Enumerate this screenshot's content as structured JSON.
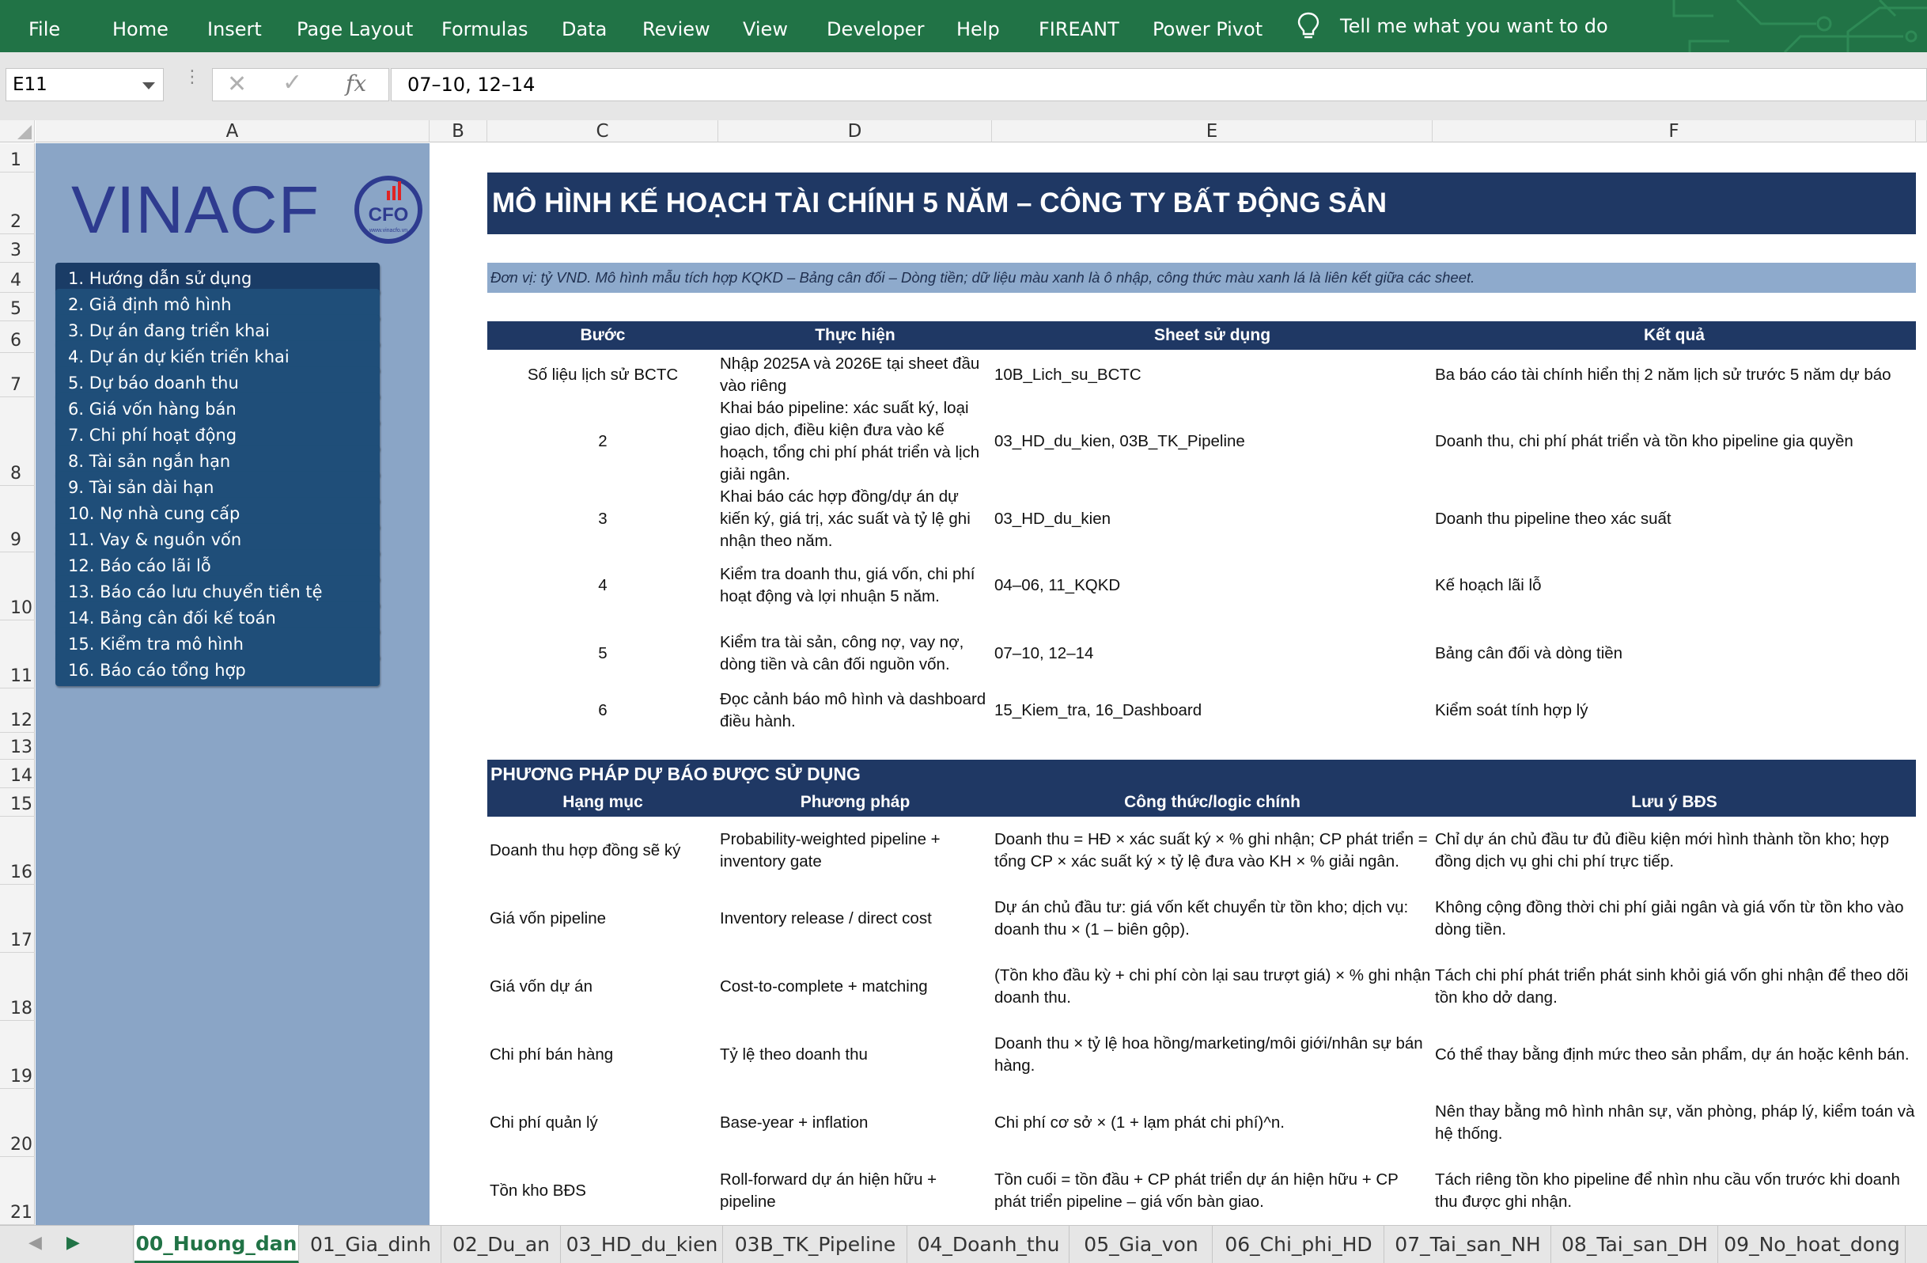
{
  "ribbon": {
    "tabs": [
      "File",
      "Home",
      "Insert",
      "Page Layout",
      "Formulas",
      "Data",
      "Review",
      "View",
      "Developer",
      "Help",
      "FIREANT",
      "Power Pivot"
    ],
    "tell_me": "Tell me what you want to do",
    "tell_icon": "lightbulb-icon",
    "color": "#217346"
  },
  "formula_bar": {
    "name_box": "E11",
    "cancel_glyph": "✕",
    "enter_glyph": "✓",
    "fx_label": "fx",
    "formula": "07–10, 12–14"
  },
  "columns": [
    "A",
    "B",
    "C",
    "D",
    "E",
    "F"
  ],
  "rows": [
    "1",
    "2",
    "3",
    "4",
    "5",
    "6",
    "7",
    "8",
    "9",
    "10",
    "11",
    "12",
    "13",
    "14",
    "15",
    "16",
    "17",
    "18",
    "19",
    "20",
    "21"
  ],
  "sidebar": {
    "logo_text": "VINACF",
    "logo_badge": "CFO",
    "logo_url": "www.vinacfo.vn",
    "nav": [
      "1. Hướng dẫn sử dụng",
      "2. Giả định mô hình",
      "3. Dự án đang triển khai",
      "4. Dự án dự kiến triển khai",
      "5. Dự báo doanh thu",
      "6. Giá vốn hàng bán",
      "7. Chi phí hoạt động",
      "8. Tài sản ngắn hạn",
      "9. Tài sản dài hạn",
      "10. Nợ nhà cung cấp",
      "11. Vay & nguồn vốn",
      "12. Báo cáo lãi lỗ",
      "13. Báo cáo lưu chuyển tiền tệ",
      "14. Bảng cân đối kế toán",
      "15. Kiểm tra mô hình",
      "16. Báo cáo tổng hợp"
    ]
  },
  "sheet": {
    "title": "MÔ HÌNH KẾ HOẠCH TÀI CHÍNH 5 NĂM – CÔNG TY BẤT ĐỘNG SẢN",
    "note": "Đơn vị: tỷ VND. Mô hình mẫu tích hợp KQKD – Bảng cân đối – Dòng tiền; dữ liệu màu xanh là ô nhập, công thức màu xanh lá là liên kết giữa các sheet.",
    "steps_header": [
      "Bước",
      "Thực hiện",
      "Sheet sử dụng",
      "Kết quả"
    ],
    "steps": [
      [
        "Số liệu lịch sử BCTC",
        "Nhập 2025A và 2026E tại sheet đầu vào riêng",
        "10B_Lich_su_BCTC",
        "Ba báo cáo tài chính hiển thị 2 năm lịch sử trước 5 năm dự báo"
      ],
      [
        "2",
        "Khai báo pipeline: xác suất ký, loại giao dịch, điều kiện đưa vào kế hoạch, tổng chi phí phát triển và lịch giải ngân.",
        "03_HD_du_kien, 03B_TK_Pipeline",
        "Doanh thu, chi phí phát triển và tồn kho pipeline gia quyền"
      ],
      [
        "3",
        "Khai báo các hợp đồng/dự án dự kiến ký, giá trị, xác suất và tỷ lệ ghi nhận theo năm.",
        "03_HD_du_kien",
        "Doanh thu pipeline theo xác suất"
      ],
      [
        "4",
        "Kiểm tra doanh thu, giá vốn, chi phí hoạt động và lợi nhuận 5 năm.",
        "04–06, 11_KQKD",
        "Kế hoạch lãi lỗ"
      ],
      [
        "5",
        "Kiểm tra tài sản, công nợ, vay nợ, dòng tiền và cân đối nguồn vốn.",
        "07–10, 12–14",
        "Bảng cân đối và dòng tiền"
      ],
      [
        "6",
        "Đọc cảnh báo mô hình và dashboard điều hành.",
        "15_Kiem_tra, 16_Dashboard",
        "Kiểm soát tính hợp lý"
      ]
    ],
    "methods_title": "PHƯƠNG PHÁP DỰ BÁO ĐƯỢC SỬ DỤNG",
    "methods_header": [
      "Hạng mục",
      "Phương pháp",
      "Công thức/logic chính",
      "Lưu ý BĐS"
    ],
    "methods": [
      [
        "Doanh thu hợp đồng sẽ ký",
        "Probability-weighted pipeline + inventory gate",
        "Doanh thu = HĐ × xác suất ký × % ghi nhận; CP phát triển = tổng CP × xác suất ký × tỷ lệ đưa vào KH × % giải ngân.",
        "Chỉ dự án chủ đầu tư đủ điều kiện mới hình thành tồn kho; hợp đồng dịch vụ ghi chi phí trực tiếp."
      ],
      [
        "Giá vốn pipeline",
        "Inventory release / direct cost",
        "Dự án chủ đầu tư: giá vốn kết chuyển từ tồn kho; dịch vụ: doanh thu × (1 – biên gộp).",
        "Không cộng đồng thời chi phí giải ngân và giá vốn từ tồn kho vào dòng tiền."
      ],
      [
        "Giá vốn dự án",
        "Cost-to-complete + matching",
        "(Tồn kho đầu kỳ + chi phí còn lại sau trượt giá) × % ghi nhận doanh thu.",
        "Tách chi phí phát triển phát sinh khỏi giá vốn ghi nhận để theo dõi tồn kho dở dang."
      ],
      [
        "Chi phí bán hàng",
        "Tỷ lệ theo doanh thu",
        "Doanh thu × tỷ lệ hoa hồng/marketing/môi giới/nhân sự bán hàng.",
        "Có thể thay bằng định mức theo sản phẩm, dự án hoặc kênh bán."
      ],
      [
        "Chi phí quản lý",
        "Base-year + inflation",
        "Chi phí cơ sở × (1 + lạm phát chi phí)^n.",
        "Nên thay bằng mô hình nhân sự, văn phòng, pháp lý, kiểm toán và hệ thống."
      ],
      [
        "Tồn kho BĐS",
        "Roll-forward dự án hiện hữu + pipeline",
        "Tồn cuối = tồn đầu + CP phát triển dự án hiện hữu + CP phát triển pipeline – giá vốn bàn giao.",
        "Tách riêng tồn kho pipeline để nhìn nhu cầu vốn trước khi doanh thu được ghi nhận."
      ]
    ]
  },
  "sheet_tabs": [
    "00_Huong_dan",
    "01_Gia_dinh",
    "02_Du_an",
    "03_HD_du_kien",
    "03B_TK_Pipeline",
    "04_Doanh_thu",
    "05_Gia_von",
    "06_Chi_phi_HD",
    "07_Tai_san_NH",
    "08_Tai_san_DH",
    "09_No_hoat_dong"
  ],
  "active_tab": "00_Huong_dan",
  "colors": {
    "header_navy": "#1f3864",
    "sidebar_bg": "#8aa5c6",
    "nav_button": "#1f4e79",
    "note_bg": "#8eaacc",
    "logo_blue": "#2e3b8f"
  }
}
